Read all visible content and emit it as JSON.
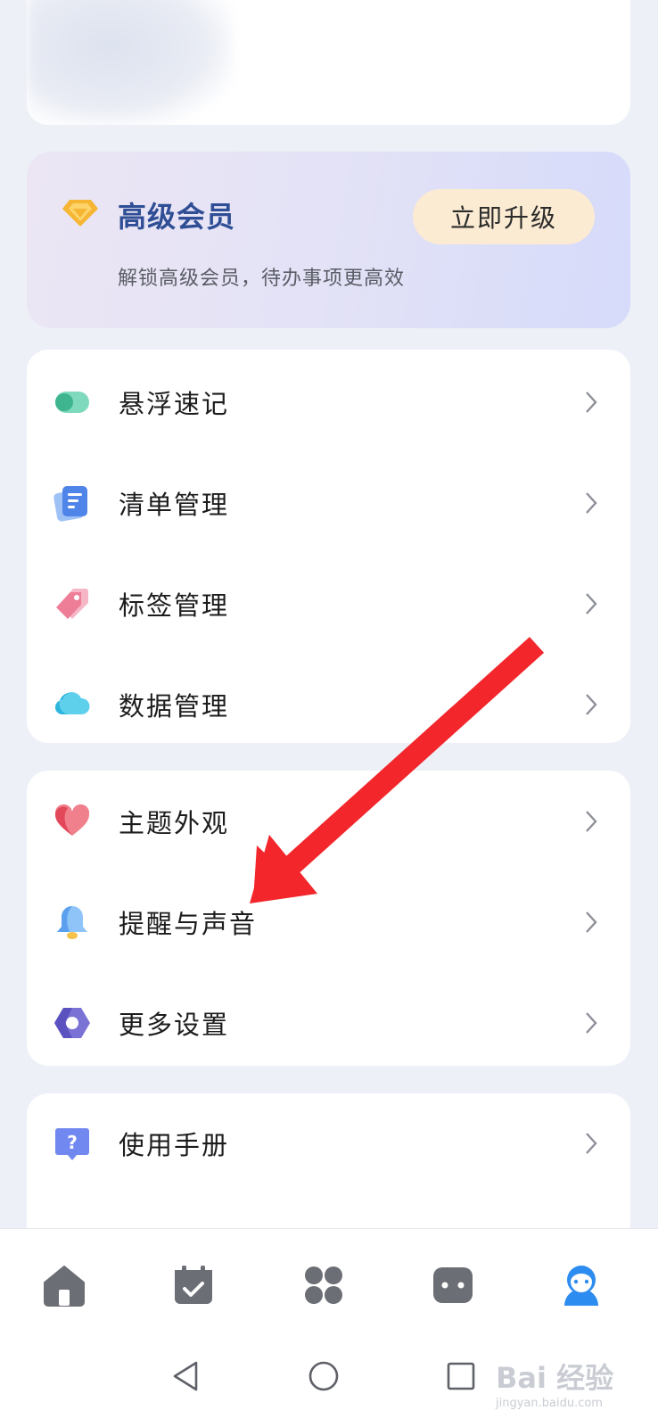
{
  "vip": {
    "title": "高级会员",
    "subtitle": "解锁高级会员，待办事项更高效",
    "upgrade_label": "立即升级"
  },
  "groups": [
    {
      "items": [
        {
          "label": "悬浮速记",
          "icon": "floating-note-icon",
          "color": "#5cc9a7"
        },
        {
          "label": "清单管理",
          "icon": "list-icon",
          "color": "#5b8def"
        },
        {
          "label": "标签管理",
          "icon": "tag-icon",
          "color": "#f08ea8"
        },
        {
          "label": "数据管理",
          "icon": "cloud-icon",
          "color": "#4cc3e6"
        }
      ]
    },
    {
      "items": [
        {
          "label": "主题外观",
          "icon": "heart-icon",
          "color": "#ef6d7a"
        },
        {
          "label": "提醒与声音",
          "icon": "bell-icon",
          "color": "#7db3f3"
        },
        {
          "label": "更多设置",
          "icon": "hexagon-settings-icon",
          "color": "#7b74d6"
        }
      ]
    },
    {
      "items": [
        {
          "label": "使用手册",
          "icon": "help-icon",
          "color": "#6f86f0"
        }
      ]
    }
  ],
  "tabbar": {
    "tabs": [
      {
        "icon": "home-icon",
        "active": false
      },
      {
        "icon": "calendar-check-icon",
        "active": false
      },
      {
        "icon": "apps-grid-icon",
        "active": false
      },
      {
        "icon": "chat-bubble-icon",
        "active": false
      },
      {
        "icon": "profile-icon",
        "active": true
      }
    ]
  },
  "watermark": {
    "main": "Bai  经验",
    "url": "jingyan.baidu.com"
  },
  "colors": {
    "accent": "#2d8cf0",
    "vip_title": "#2f4e95",
    "annotation_arrow": "#f2262b"
  }
}
